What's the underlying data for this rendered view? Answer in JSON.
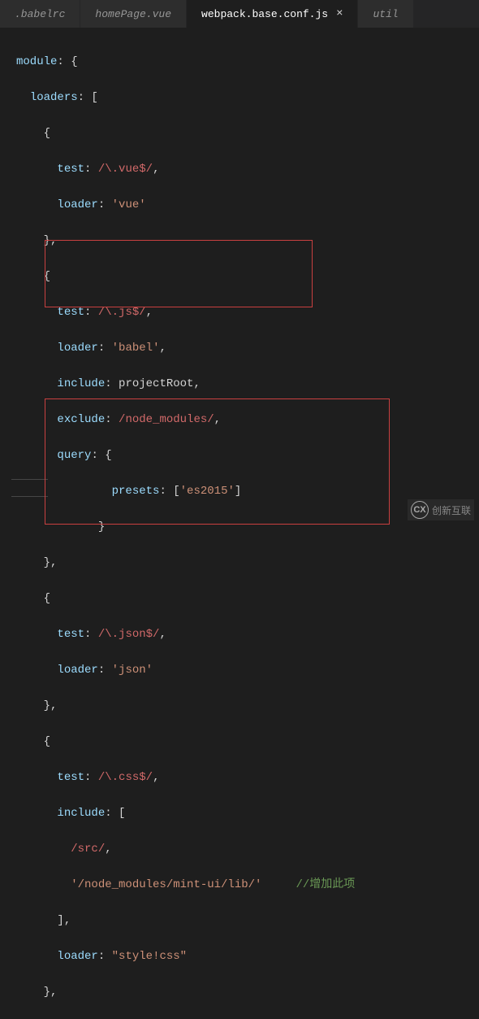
{
  "tabs": [
    {
      "label": ".babelrc",
      "active": false
    },
    {
      "label": "homePage.vue",
      "active": false
    },
    {
      "label": "webpack.base.conf.js",
      "active": true
    },
    {
      "label": "util",
      "active": false
    }
  ],
  "code": {
    "l1a": "module",
    "l1b": ": {",
    "l2a": "loaders",
    "l2b": ": [",
    "l3": "{",
    "l4a": "test",
    "l4b": ": ",
    "l4c": "/\\.vue$/",
    "l4d": ",",
    "l5a": "loader",
    "l5b": ": ",
    "l5c": "'vue'",
    "l6": "},",
    "l7": "{",
    "l8a": "test",
    "l8b": ": ",
    "l8c": "/\\.js$/",
    "l8d": ",",
    "l9a": "loader",
    "l9b": ": ",
    "l9c": "'babel'",
    "l9d": ",",
    "l10a": "include",
    "l10b": ": projectRoot,",
    "l11a": "exclude",
    "l11b": ": ",
    "l11c": "/node_modules/",
    "l11d": ",",
    "l12a": "query",
    "l12b": ": {",
    "l13a": "presets",
    "l13b": ": [",
    "l13c": "'es2015'",
    "l13d": "]",
    "l14": "}",
    "l15": "},",
    "l16": "{",
    "l17a": "test",
    "l17b": ": ",
    "l17c": "/\\.json$/",
    "l17d": ",",
    "l18a": "loader",
    "l18b": ": ",
    "l18c": "'json'",
    "l19": "},",
    "l20": "{",
    "l21a": "test",
    "l21b": ": ",
    "l21c": "/\\.css$/",
    "l21d": ",",
    "l22a": "include",
    "l22b": ": [",
    "l23a": "/src/",
    "l23b": ",",
    "l24a": "'/node_modules/mint-ui/lib/'",
    "l24cmt": "//增加此项",
    "l25": "],",
    "l26a": "loader",
    "l26b": ": ",
    "l26c": "\"style!css\"",
    "l27": "},"
  },
  "watermark": {
    "logo": "CX",
    "text": "创新互联"
  }
}
